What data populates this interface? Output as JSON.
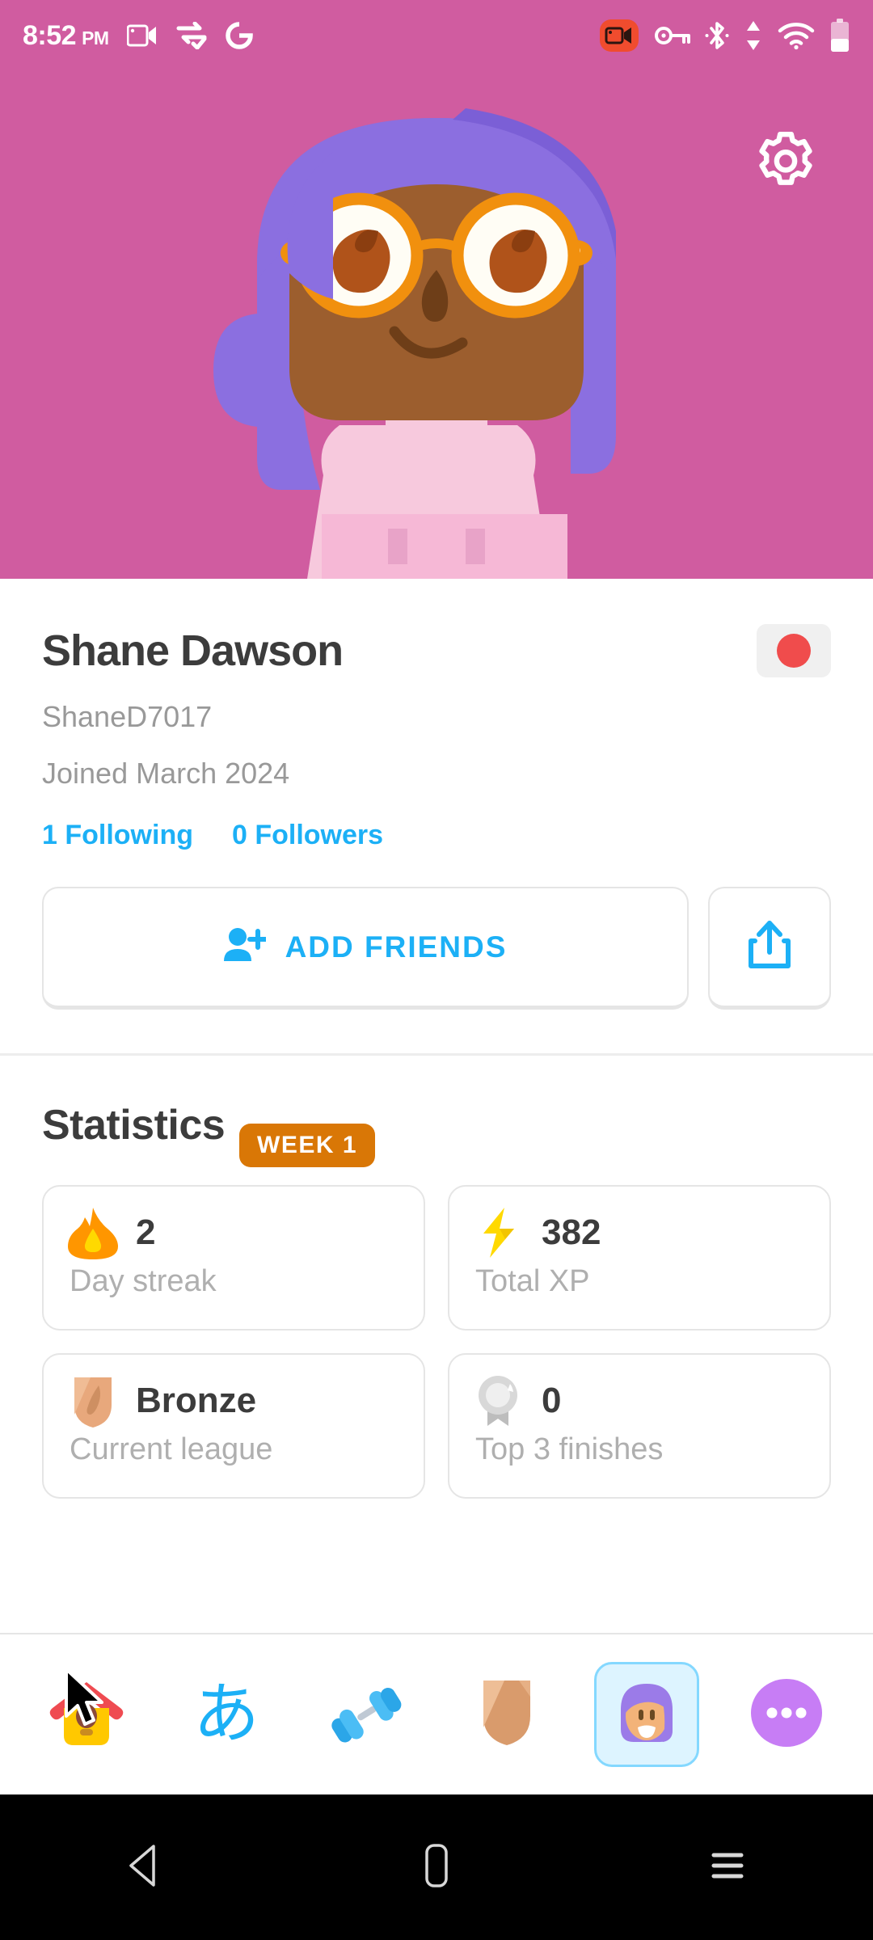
{
  "status_bar": {
    "time": "8:52",
    "ampm": "PM",
    "left_icons": [
      "video-camera-icon",
      "data-transfer-check-icon",
      "google-icon"
    ],
    "right_icons": [
      "screen-record-icon",
      "vpn-key-icon",
      "bluetooth-icon",
      "data-transfer-icon",
      "wifi-icon",
      "battery-icon"
    ],
    "colors": {
      "background": "#D05CA0",
      "foreground": "#FFFFFF",
      "record_badge": "#F04C2E"
    }
  },
  "header": {
    "settings_label": "gear-icon",
    "background_color": "#D05CA0",
    "avatar": {
      "hair_color": "#8B6FE0",
      "hair_shadow": "#7B5FD6",
      "skin_color": "#9C5E2E",
      "glasses_color": "#F1900E",
      "eye_color": "#B0531A",
      "shirt_color": "#F6B8D6",
      "neck_color": "#F7C9DD"
    }
  },
  "profile": {
    "display_name": "Shane Dawson",
    "username": "ShaneD7017",
    "joined": "Joined March 2024",
    "flag": {
      "name": "japan-flag",
      "background": "#F0F0F0",
      "dot_color": "#F04C4C"
    },
    "following": "1 Following",
    "followers": "0 Followers",
    "add_friends_label": "ADD FRIENDS",
    "share_label": "share-icon",
    "accent_color": "#1CB0F6"
  },
  "statistics": {
    "title": "Statistics",
    "week_badge": "WEEK 1",
    "week_badge_color": "#D97706",
    "cards": [
      {
        "icon": "flame-icon",
        "value": "2",
        "label": "Day streak",
        "icon_color": "#FF9600"
      },
      {
        "icon": "lightning-bolt-icon",
        "value": "382",
        "label": "Total XP",
        "icon_color": "#FFD900"
      },
      {
        "icon": "bronze-shield-icon",
        "value": "Bronze",
        "label": "Current league",
        "icon_color": "#E8A87C"
      },
      {
        "icon": "medal-icon",
        "value": "0",
        "label": "Top 3 finishes",
        "icon_color": "#C8C8C8"
      }
    ]
  },
  "bottom_nav": {
    "items": [
      {
        "name": "learn",
        "icon": "birdhouse-icon",
        "active": false
      },
      {
        "name": "alphabets",
        "icon": "kana-a-icon",
        "glyph": "あ",
        "active": false
      },
      {
        "name": "practice",
        "icon": "dumbbell-icon",
        "active": false
      },
      {
        "name": "leagues",
        "icon": "bronze-shield-icon",
        "active": false
      },
      {
        "name": "profile",
        "icon": "profile-avatar-icon",
        "active": true
      },
      {
        "name": "more",
        "icon": "more-dots-icon",
        "active": false
      }
    ],
    "active_bg": "#DDF4FF",
    "active_border": "#84D8FF"
  },
  "system_nav": {
    "back": "back-triangle-icon",
    "home": "home-square-icon",
    "recents": "recents-hamburger-icon",
    "background": "#000000"
  }
}
